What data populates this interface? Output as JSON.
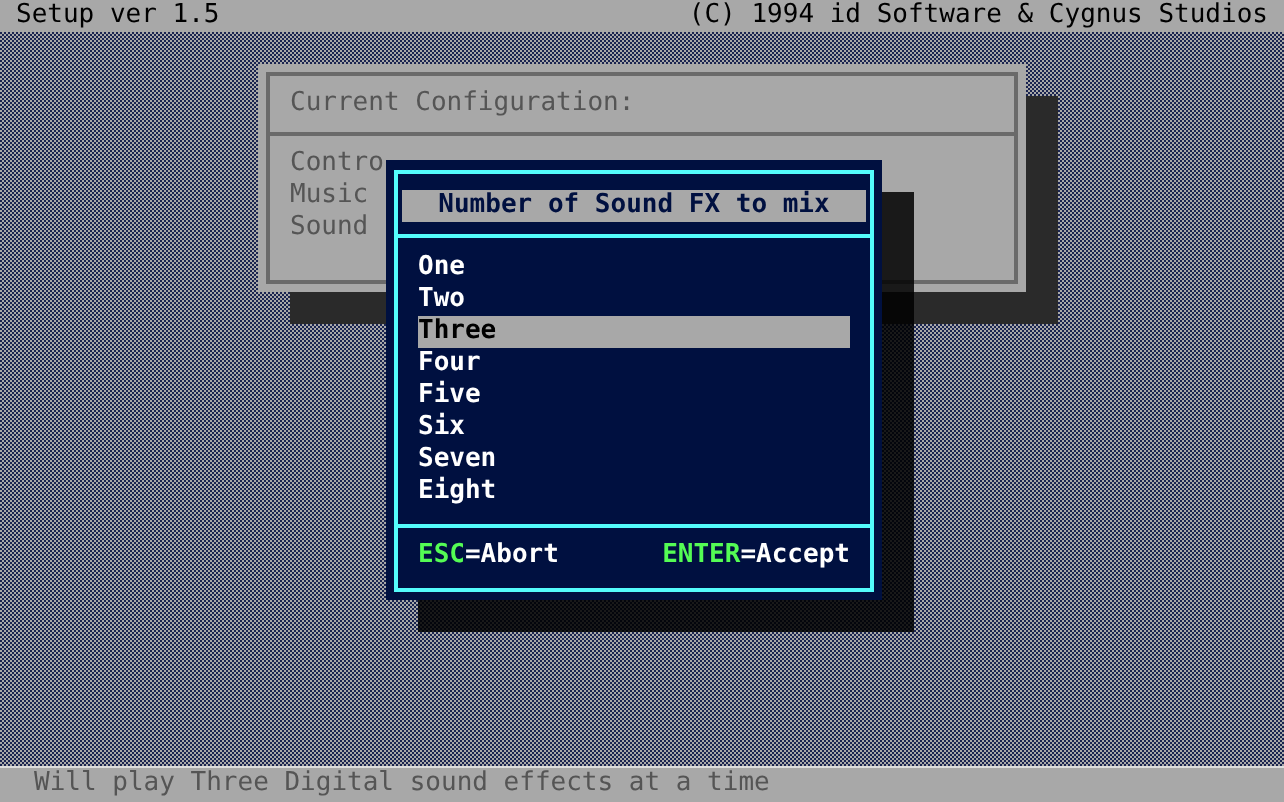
{
  "title_bar": {
    "title": "Setup ver 1.5",
    "copyright": "(C) 1994 id Software & Cygnus Studios"
  },
  "config_panel": {
    "heading": "Current Configuration:",
    "rows": [
      "Contro",
      "Music",
      "Sound"
    ]
  },
  "dialog": {
    "title": "Number of Sound FX to mix",
    "options": [
      {
        "label": "One",
        "selected": false
      },
      {
        "label": "Two",
        "selected": false
      },
      {
        "label": "Three",
        "selected": true
      },
      {
        "label": "Four",
        "selected": false
      },
      {
        "label": "Five",
        "selected": false
      },
      {
        "label": "Six",
        "selected": false
      },
      {
        "label": "Seven",
        "selected": false
      },
      {
        "label": "Eight",
        "selected": false
      }
    ],
    "keys": [
      {
        "key": "ESC",
        "action": "=Abort"
      },
      {
        "key": "ENTER",
        "action": "=Accept"
      }
    ]
  },
  "status_bar": {
    "text": "Will play Three Digital sound effects at a time"
  }
}
